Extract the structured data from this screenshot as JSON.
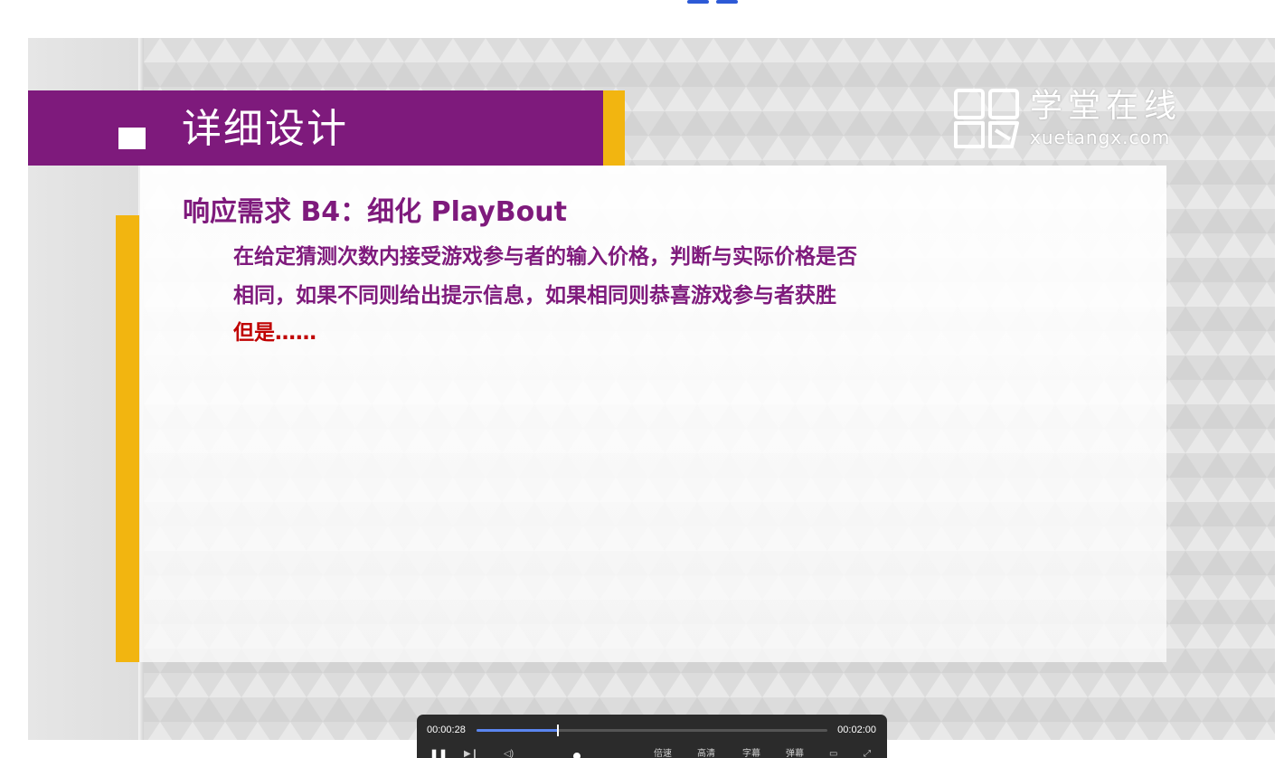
{
  "slide": {
    "title": "详细设计",
    "logo": {
      "cn": "学堂在线",
      "en": "xuetangx.com"
    },
    "heading": "响应需求 B4：细化 PlayBout",
    "body_lines": [
      "在给定猜测次数内接受游戏参与者的输入价格，判断与实际价格是否",
      "相同，如果不同则给出提示信息，如果相同则恭喜游戏参与者获胜"
    ],
    "but_text": "但是……"
  },
  "player": {
    "current_time": "00:00:28",
    "total_time": "00:02:00",
    "progress": 0.233,
    "volume": 0.55,
    "controls": {
      "play_pause_icon": "pause-icon",
      "speed": "倍速",
      "quality": "高清",
      "subtitle": "字幕",
      "danmaku": "弹幕"
    }
  },
  "colors": {
    "title_band": "#7e1a7c",
    "accent": "#f2b510",
    "heading_text": "#7e1a7c",
    "alert_text": "#c00000",
    "progress": "#5b86f0",
    "player_bg": "#2b2b2b"
  }
}
